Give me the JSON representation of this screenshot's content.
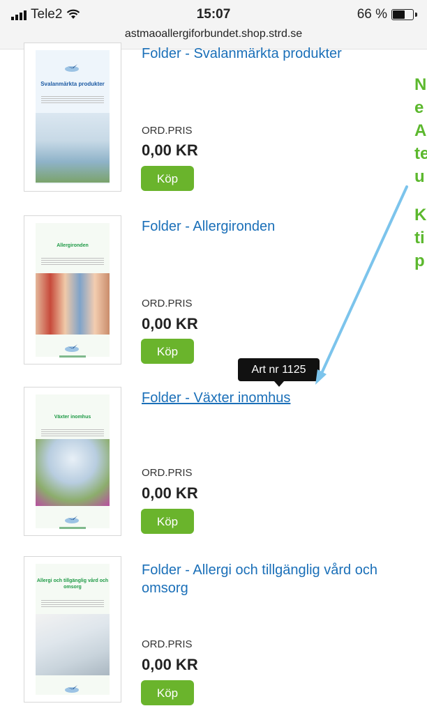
{
  "status_bar": {
    "carrier": "Tele2",
    "time": "15:07",
    "battery": "66 %",
    "battery_level_percent": 66,
    "url": "astmaoallergiforbundet.shop.strd.se"
  },
  "products": [
    {
      "title": "Folder - Svalanmärkta produkter",
      "price_label": "ORD.PRIS",
      "price": "0,00 KR",
      "buy_label": "Köp",
      "thumb_title": "Svalanmärkta produkter",
      "thumb_color": "#2a6fb5"
    },
    {
      "title": "Folder - Allergironden",
      "price_label": "ORD.PRIS",
      "price": "0,00 KR",
      "buy_label": "Köp",
      "thumb_title": "Allergironden",
      "thumb_color": "#2b9a4a"
    },
    {
      "title": "Folder - Växter inomhus",
      "price_label": "ORD.PRIS",
      "price": "0,00 KR",
      "buy_label": "Köp",
      "thumb_title": "Växter inomhus",
      "thumb_color": "#2b9a4a"
    },
    {
      "title": "Folder - Allergi och tillgänglig vård och omsorg",
      "price_label": "ORD.PRIS",
      "price": "0,00 KR",
      "buy_label": "Köp",
      "thumb_title": "Allergi och tillgänglig vård och omsorg",
      "thumb_color": "#2b9a4a"
    }
  ],
  "tooltip": "Art nr 1125",
  "annotation_fragments": [
    "N",
    "e",
    "A",
    "te",
    "u",
    "K",
    "ti",
    "p"
  ],
  "colors": {
    "link": "#1a6fb8",
    "buy_button": "#6ab42c",
    "annotation": "#5cb82e",
    "arrow": "#7cc4ec"
  },
  "icons": [
    "signal-icon",
    "wifi-icon",
    "battery-icon",
    "swallow-logo-icon"
  ]
}
